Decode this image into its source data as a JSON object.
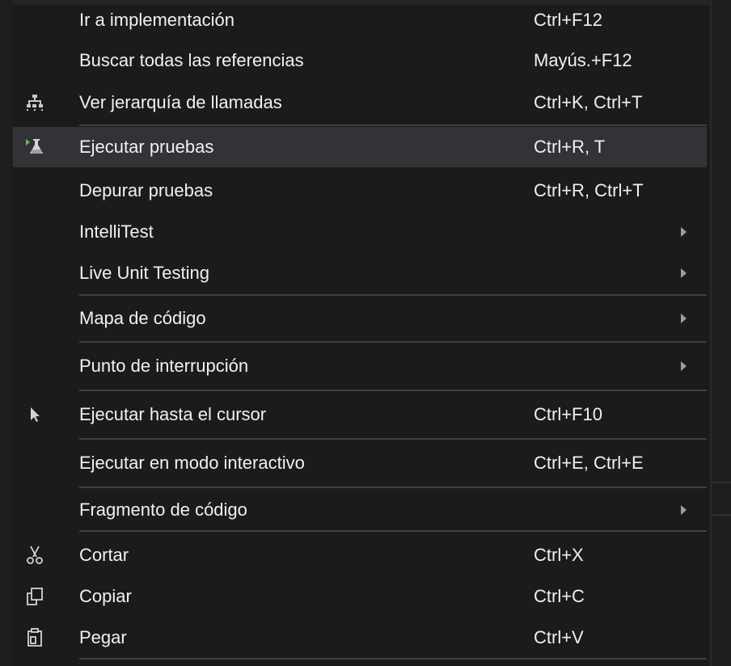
{
  "context_menu": {
    "items": [
      {
        "id": "go-to-implementation",
        "label": "Ir a implementación",
        "shortcut": "Ctrl+F12",
        "icon": "",
        "submenu": false,
        "active": false
      },
      {
        "id": "find-all-references",
        "label": "Buscar todas las referencias",
        "shortcut": "Mayús.+F12",
        "icon": "",
        "submenu": false,
        "active": false
      },
      {
        "id": "view-call-hierarchy",
        "label": "Ver jerarquía de llamadas",
        "shortcut": "Ctrl+K, Ctrl+T",
        "icon": "call-hierarchy-icon",
        "submenu": false,
        "active": false
      },
      {
        "id": "run-tests",
        "label": "Ejecutar pruebas",
        "shortcut": "Ctrl+R, T",
        "icon": "run-tests-icon",
        "submenu": false,
        "active": true
      },
      {
        "id": "debug-tests",
        "label": "Depurar pruebas",
        "shortcut": "Ctrl+R, Ctrl+T",
        "icon": "",
        "submenu": false,
        "active": false
      },
      {
        "id": "intellitest",
        "label": "IntelliTest",
        "shortcut": "",
        "icon": "",
        "submenu": true,
        "active": false
      },
      {
        "id": "live-unit-testing",
        "label": "Live Unit Testing",
        "shortcut": "",
        "icon": "",
        "submenu": true,
        "active": false
      },
      {
        "id": "code-map",
        "label": "Mapa de código",
        "shortcut": "",
        "icon": "",
        "submenu": true,
        "active": false
      },
      {
        "id": "breakpoint",
        "label": "Punto de interrupción",
        "shortcut": "",
        "icon": "",
        "submenu": true,
        "active": false
      },
      {
        "id": "run-to-cursor",
        "label": "Ejecutar hasta el cursor",
        "shortcut": "Ctrl+F10",
        "icon": "cursor-arrow-icon",
        "submenu": false,
        "active": false
      },
      {
        "id": "execute-in-interactive",
        "label": "Ejecutar en modo interactivo",
        "shortcut": "Ctrl+E, Ctrl+E",
        "icon": "",
        "submenu": false,
        "active": false
      },
      {
        "id": "code-snippet",
        "label": "Fragmento de código",
        "shortcut": "",
        "icon": "",
        "submenu": true,
        "active": false
      },
      {
        "id": "cut",
        "label": "Cortar",
        "shortcut": "Ctrl+X",
        "icon": "scissors-icon",
        "submenu": false,
        "active": false
      },
      {
        "id": "copy",
        "label": "Copiar",
        "shortcut": "Ctrl+C",
        "icon": "copy-icon",
        "submenu": false,
        "active": false
      },
      {
        "id": "paste",
        "label": "Pegar",
        "shortcut": "Ctrl+V",
        "icon": "paste-icon",
        "submenu": false,
        "active": false
      }
    ]
  },
  "colors": {
    "menu_background": "#1b1b1c",
    "hover_background": "#333337",
    "text": "#f1f1f1",
    "separator": "#3f3f46",
    "accent_green": "#5fbf4a"
  }
}
